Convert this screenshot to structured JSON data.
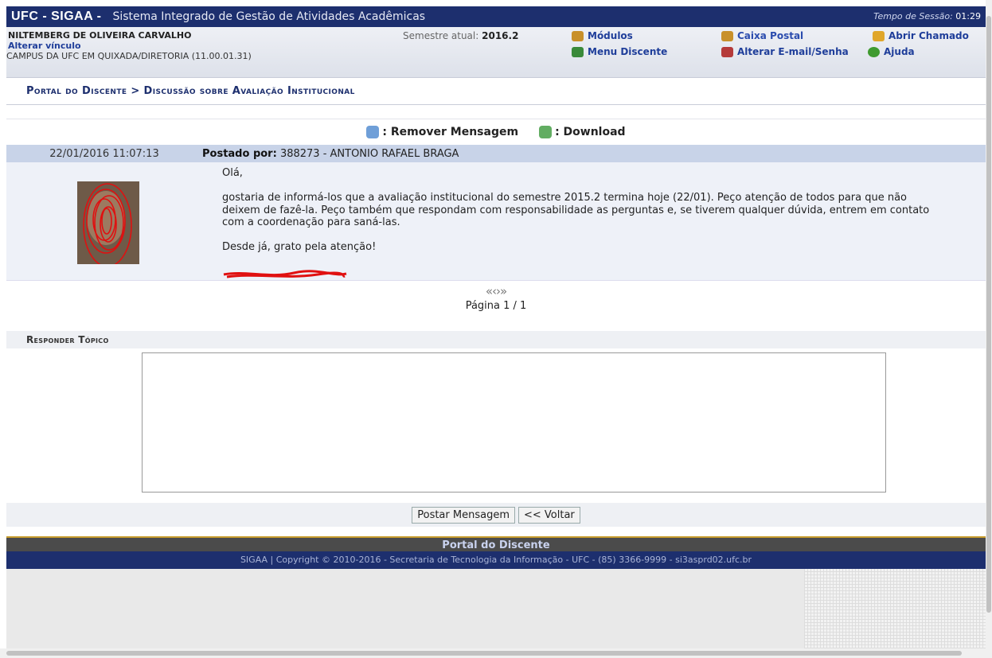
{
  "header": {
    "system": "UFC - SIGAA -",
    "system_full": "Sistema Integrado de Gestão de Atividades Acadêmicas",
    "session_label": "Tempo de Sessão:",
    "session_time": "01:29"
  },
  "user": {
    "name": "NILTEMBERG DE OLIVEIRA CARVALHO",
    "change_link": "Alterar vínculo",
    "campus": "CAMPUS DA UFC EM QUIXADA/DIRETORIA (11.00.01.31)",
    "semester_label": "Semestre atual:",
    "semester": "2016.2"
  },
  "menu": {
    "modulos": "Módulos",
    "caixa": "Caixa Postal",
    "chamado": "Abrir Chamado",
    "discente": "Menu Discente",
    "email": "Alterar E-mail/Senha",
    "ajuda": "Ajuda"
  },
  "breadcrumb": "Portal do Discente > Discussão sobre Avaliação Institucional",
  "actions": {
    "remove": ": Remover Mensagem",
    "download": ": Download"
  },
  "post": {
    "date": "22/01/2016 11:07:13",
    "posted_by_label": "Postado por:",
    "author": "388273 - ANTONIO RAFAEL BRAGA",
    "body": "Olá,\n\ngostaria de informá-los que a avaliação institucional do semestre 2015.2 termina hoje (22/01). Peço atenção de todos para que não\ndeixem de fazê-la. Peço também que respondam com responsabilidade as perguntas e, se tiverem qualquer dúvida, entrem em contato\ncom a coordenação para saná-las.\n\nDesde já, grato pela atenção!"
  },
  "pager": {
    "page": "Página 1 / 1",
    "arrows": "«‹›»"
  },
  "reply": {
    "title": "Responder Tópico",
    "submit": "Postar Mensagem",
    "back": "<< Voltar"
  },
  "footer": {
    "portal": "Portal do Discente",
    "copyright": "SIGAA | Copyright © 2010-2016 - Secretaria de Tecnologia da Informação - UFC - (85) 3366-9999 - si3asprd02.ufc.br"
  },
  "colors": {
    "banner": "#1d2f6e",
    "highlight": "#c8d3e8",
    "link": "#1f3e9a"
  }
}
